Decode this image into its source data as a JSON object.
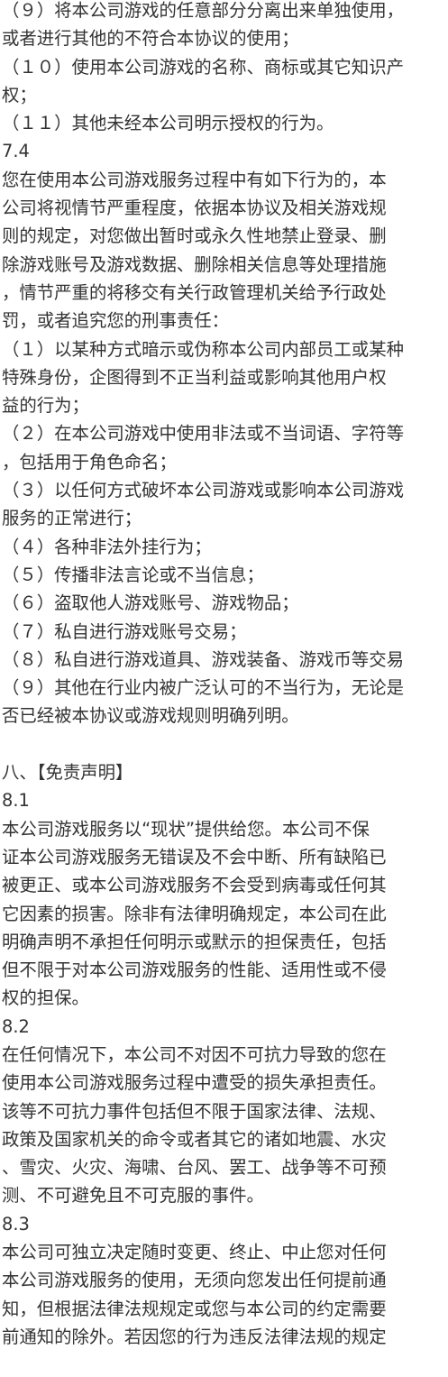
{
  "document": {
    "lines": [
      "（９）将本公司游戏的任意部分分离出来单独使用，",
      "或者进行其他的不符合本协议的使用；",
      "（１０）使用本公司游戏的名称、商标或其它知识产",
      "权；",
      "（１１）其他未经本公司明示授权的行为。",
      "7.4",
      "您在使用本公司游戏服务过程中有如下行为的，本",
      "公司将视情节严重程度，依据本协议及相关游戏规",
      "则的规定，对您做出暂时或永久性地禁止登录、删",
      "除游戏账号及游戏数据、删除相关信息等处理措施",
      "，情节严重的将移交有关行政管理机关给予行政处",
      "罚，或者追究您的刑事责任：",
      "（１）以某种方式暗示或伪称本公司内部员工或某种",
      "特殊身份，企图得到不正当利益或影响其他用户权",
      "益的行为；",
      "（２）在本公司游戏中使用非法或不当词语、字符等",
      "，包括用于角色命名；",
      "（３）以任何方式破坏本公司游戏或影响本公司游戏",
      "服务的正常进行；",
      "（４）各种非法外挂行为；",
      "（５）传播非法言论或不当信息；",
      "（６）盗取他人游戏账号、游戏物品；",
      "（７）私自进行游戏账号交易；",
      "（８）私自进行游戏道具、游戏装备、游戏币等交易",
      "（９）其他在行业内被广泛认可的不当行为，无论是",
      "否已经被本协议或游戏规则明确列明。",
      "",
      "八、【免责声明】",
      "8.1",
      "本公司游戏服务以“现状”提供给您。本公司不保",
      "证本公司游戏服务无错误及不会中断、所有缺陷已",
      "被更正、或本公司游戏服务不会受到病毒或任何其",
      "它因素的损害。除非有法律明确规定，本公司在此",
      "明确声明不承担任何明示或默示的担保责任，包括",
      "但不限于对本公司游戏服务的性能、适用性或不侵",
      "权的担保。",
      "8.2",
      "在任何情况下，本公司不对因不可抗力导致的您在",
      "使用本公司游戏服务过程中遭受的损失承担责任。",
      "该等不可抗力事件包括但不限于国家法律、法规、",
      "政策及国家机关的命令或者其它的诸如地震、水灾",
      "、雪灾、火灾、海啸、台风、罢工、战争等不可预",
      "测、不可避免且不可克服的事件。",
      "8.3",
      "本公司可独立决定随时变更、终止、中止您对任何",
      "本公司游戏服务的使用，无须向您发出任何提前通",
      "知，但根据法律法规规定或您与本公司的约定需要",
      "前通知的除外。若因您的行为违反法律法规的规定"
    ]
  }
}
